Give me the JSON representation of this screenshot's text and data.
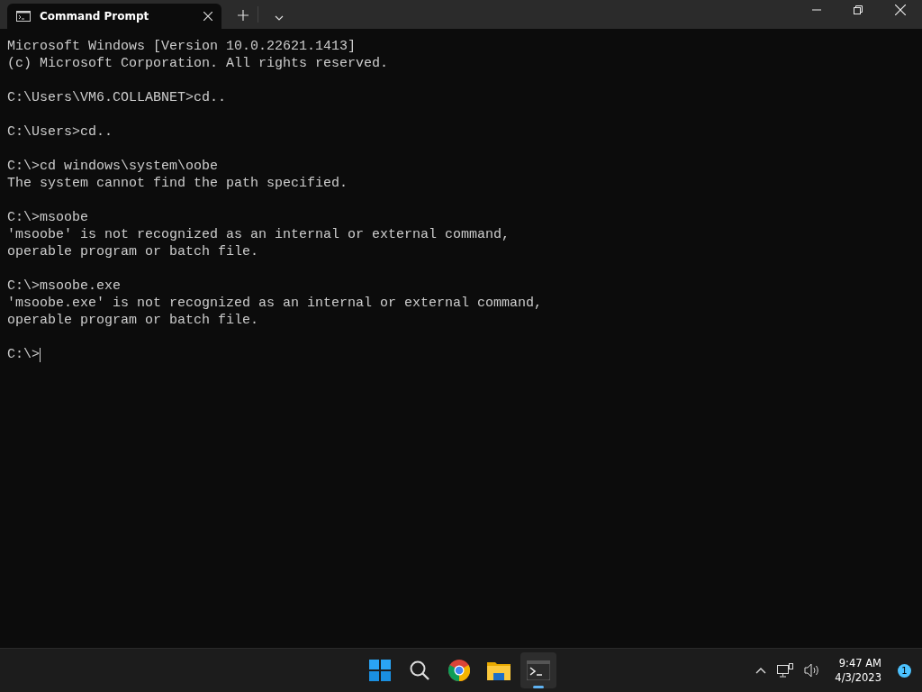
{
  "window": {
    "tabs": [
      {
        "title": "Command Prompt",
        "selected": true
      }
    ]
  },
  "console": {
    "blocks": [
      [
        "Microsoft Windows [Version 10.0.22621.1413]",
        "(c) Microsoft Corporation. All rights reserved."
      ],
      [
        "C:\\Users\\VM6.COLLABNET>cd.."
      ],
      [
        "C:\\Users>cd.."
      ],
      [
        "C:\\>cd windows\\system\\oobe",
        "The system cannot find the path specified."
      ],
      [
        "C:\\>msoobe",
        "'msoobe' is not recognized as an internal or external command,",
        "operable program or batch file."
      ],
      [
        "C:\\>msoobe.exe",
        "'msoobe.exe' is not recognized as an internal or external command,",
        "operable program or batch file."
      ],
      [
        "C:\\>"
      ]
    ]
  },
  "taskbar": {
    "apps": [
      {
        "kind": "start",
        "selected": false
      },
      {
        "kind": "search",
        "selected": false
      },
      {
        "kind": "browser",
        "selected": false
      },
      {
        "kind": "folder",
        "selected": false
      },
      {
        "kind": "terminal",
        "selected": true
      }
    ],
    "time": "9:47 AM",
    "date": "4/3/2023",
    "notification_count": "1"
  }
}
